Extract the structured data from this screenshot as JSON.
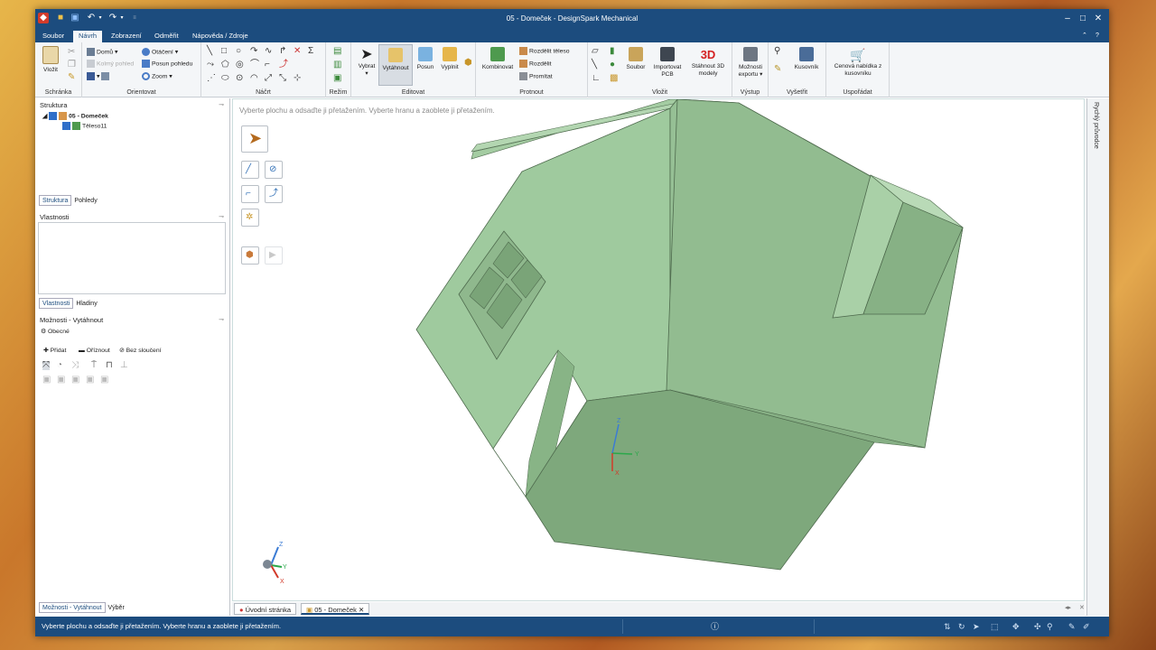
{
  "window": {
    "title": "05 - Domeček - DesignSpark Mechanical"
  },
  "menu": {
    "tabs": [
      "Soubor",
      "Návrh",
      "Zobrazení",
      "Odměřit",
      "Nápověda / Zdroje"
    ]
  },
  "ribbon": {
    "schranka": {
      "label": "Schránka",
      "vlozit": "Vložit"
    },
    "orientovat": {
      "label": "Orientovat",
      "domu": "Domů",
      "kolmy": "Kolmý pohled",
      "otaceni": "Otáčení",
      "posun": "Posun pohledu",
      "zoom": "Zoom"
    },
    "nacrt": {
      "label": "Náčrt"
    },
    "rezim": {
      "label": "Režim"
    },
    "editovat": {
      "label": "Editovat",
      "vybrat": "Vybrat",
      "vytahnout": "Vytáhnout",
      "posun": "Posun",
      "vyplnit": "Vyplnit"
    },
    "protnout": {
      "label": "Protnout",
      "kombinovat": "Kombinovat",
      "rozdelit_teleso": "Rozdělit těleso",
      "rozdelit": "Rozdělit",
      "promitat": "Promítat"
    },
    "vlozit": {
      "label": "Vložit",
      "soubor": "Soubor",
      "importovat": "Importovat PCB",
      "stahnout": "Stáhnout 3D modely",
      "badge": "3D"
    },
    "vystup": {
      "label": "Výstup",
      "moznosti": "Možnosti exportu"
    },
    "vysetrit": {
      "label": "Vyšetřit",
      "kusovnik": "Kusovník"
    },
    "usporadat": {
      "label": "Uspořádat",
      "cenova": "Cenová nabídka z kusovníku"
    }
  },
  "structure": {
    "title": "Struktura",
    "root": "05 - Domeček",
    "child": "Těleso11",
    "tabs": [
      "Struktura",
      "Pohledy"
    ]
  },
  "properties": {
    "title": "Vlastnosti",
    "tabs": [
      "Vlastnosti",
      "Hladiny"
    ]
  },
  "options": {
    "title": "Možnosti - Vytáhnout",
    "section": "Obecné",
    "pridat": "Přidat",
    "oriznout": "Oříznout",
    "bez": "Bez sloučení"
  },
  "left_bottom_tabs": [
    "Možnosti - Vytáhnout",
    "Výběr"
  ],
  "canvas": {
    "hint": "Vyberte plochu a odsaďte ji přetažením. Vyberte hranu a zaoblete ji přetažením.",
    "axes": {
      "z": "Z",
      "y": "Y",
      "x": "X"
    }
  },
  "right_panel": {
    "label": "Rychlý průvodce"
  },
  "doc_tabs": [
    "Úvodní stránka",
    "05 - Domeček"
  ],
  "status": {
    "text": "Vyberte plochu a odsaďte ji přetažením. Vyberte hranu a zaoblete ji přetažením."
  },
  "colors": {
    "chrome": "#1c4c7e",
    "model_light": "#9fca9e",
    "model_mid": "#8fb88d",
    "model_dark": "#7aa478"
  }
}
